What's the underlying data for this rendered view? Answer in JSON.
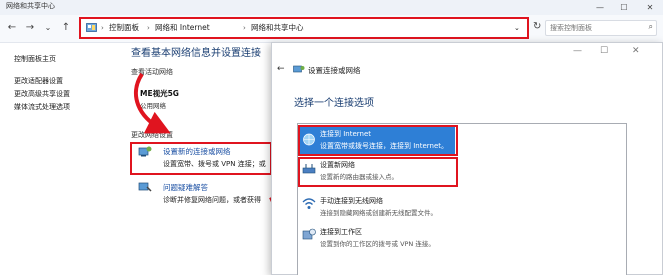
{
  "window": {
    "title": "网络和共享中心",
    "controls": {
      "minimize": "—",
      "maximize": "☐",
      "close": "✕"
    }
  },
  "nav": {
    "back": "←",
    "forward": "→",
    "dropdown": "⌄",
    "up": "↑",
    "refresh": "↻"
  },
  "address_bar": {
    "crumbs": [
      "控制面板",
      "网络和 Internet",
      "网络和共享中心"
    ],
    "separator": "›",
    "dropdown": "⌄"
  },
  "search": {
    "placeholder": "搜索控制面板"
  },
  "sidebar": {
    "items": [
      {
        "label": "控制面板主页"
      },
      {
        "label": "更改适配器设置"
      },
      {
        "label": "更改高级共享设置"
      },
      {
        "label": "媒体流式处理选项"
      }
    ]
  },
  "main": {
    "heading": "查看基本网络信息并设置连接",
    "active_networks_label": "查看活动网络",
    "network_name": "ME视光5G",
    "network_type": "公用网络",
    "change_settings_label": "更改网络设置",
    "items": [
      {
        "link": "设置新的连接或网络",
        "desc": "设置宽带、拨号或 VPN 连接；或"
      },
      {
        "link": "问题疑难解答",
        "desc": "诊断并修复网络问题，或者获得"
      }
    ]
  },
  "dialog": {
    "title": "设置连接或网络",
    "heading": "选择一个连接选项",
    "controls": {
      "minimize": "—",
      "maximize": "☐",
      "close": "✕"
    },
    "back": "←",
    "options": [
      {
        "title": "连接到 Internet",
        "desc": "设置宽带或拨号连接，连接到 Internet。",
        "selected": true
      },
      {
        "title": "设置新网络",
        "desc": "设置新的路由器或接入点。",
        "selected": false
      },
      {
        "title": "手动连接到无线网络",
        "desc": "连接到隐藏网络或创建新无线配置文件。",
        "selected": false
      },
      {
        "title": "连接到工作区",
        "desc": "设置到你的工作区的拨号或 VPN 连接。",
        "selected": false
      }
    ]
  },
  "colors": {
    "highlight_red": "#e0141f",
    "selection_blue": "#2e7fd6",
    "link_blue": "#1a4fa3",
    "heading_blue": "#1a3e72"
  }
}
